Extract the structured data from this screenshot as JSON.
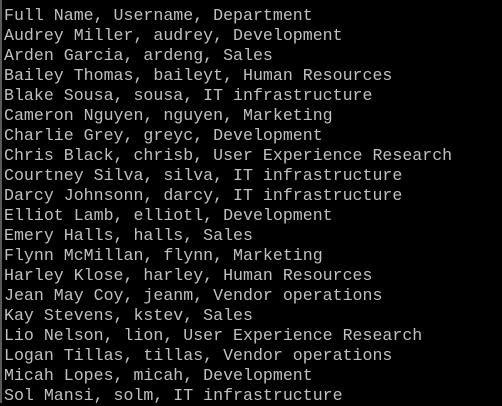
{
  "terminal": {
    "lines": [
      "",
      "Full Name, Username, Department",
      "Audrey Miller, audrey, Development",
      "Arden Garcia, ardeng, Sales",
      "Bailey Thomas, baileyt, Human Resources",
      "Blake Sousa, sousa, IT infrastructure",
      "Cameron Nguyen, nguyen, Marketing",
      "Charlie Grey, greyc, Development",
      "Chris Black, chrisb, User Experience Research",
      "Courtney Silva, silva, IT infrastructure",
      "Darcy Johnsonn, darcy, IT infrastructure",
      "Elliot Lamb, elliotl, Development",
      "Emery Halls, halls, Sales",
      "Flynn McMillan, flynn, Marketing",
      "Harley Klose, harley, Human Resources",
      "Jean May Coy, jeanm, Vendor operations",
      "Kay Stevens, kstev, Sales",
      "Lio Nelson, lion, User Experience Research",
      "Logan Tillas, tillas, Vendor operations",
      "Micah Lopes, micah, Development",
      "Sol Mansi, solm, IT infrastructure"
    ]
  }
}
